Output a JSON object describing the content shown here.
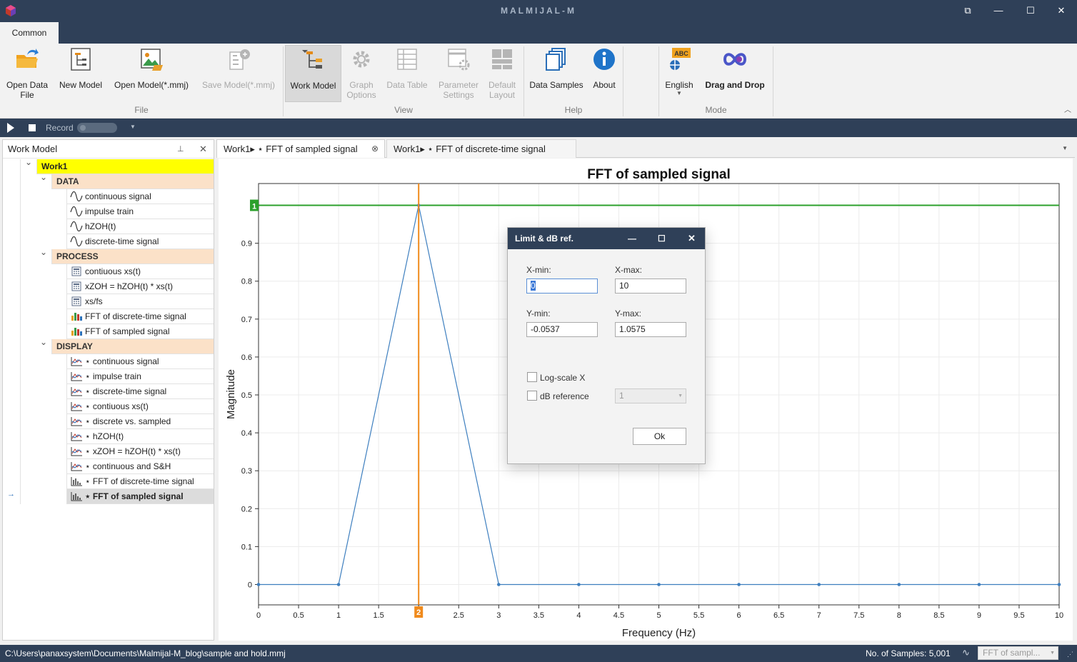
{
  "app": {
    "title": "MALMIJAL-M"
  },
  "ribbon": {
    "tab": "Common",
    "buttons": {
      "open_data": "Open Data File",
      "new_model": "New Model",
      "open_model": "Open Model(*.mmj)",
      "save_model": "Save Model(*.mmj)",
      "work_model": "Work Model",
      "graph_options_1": "Graph",
      "graph_options_2": "Options",
      "data_table": "Data Table",
      "parameter_settings_1": "Parameter",
      "parameter_settings_2": "Settings",
      "default_layout_1": "Default",
      "default_layout_2": "Layout",
      "data_samples": "Data Samples",
      "about": "About",
      "english": "English",
      "drag_drop": "Drag and Drop",
      "open_data_1": "Open Data",
      "open_data_2": "File"
    },
    "groups": {
      "file": "File",
      "view": "View",
      "help": "Help",
      "mode": "Mode"
    }
  },
  "recordbar": {
    "record": "Record"
  },
  "work_model": {
    "header": "Work Model",
    "root": "Work1",
    "groups": [
      {
        "label": "DATA",
        "items": [
          "continuous signal",
          "impulse train",
          "hZOH(t)",
          "discrete-time signal"
        ]
      },
      {
        "label": "PROCESS",
        "items": [
          "contiuous xs(t)",
          "xZOH = hZOH(t) * xs(t)",
          "xs/fs",
          "FFT of discrete-time signal",
          "FFT of sampled signal"
        ]
      },
      {
        "label": "DISPLAY",
        "items": [
          "⋆ continuous signal",
          "⋆ impulse train",
          "⋆ discrete-time signal",
          "⋆ contiuous xs(t)",
          "⋆ discrete vs. sampled",
          "⋆ hZOH(t)",
          "⋆ xZOH = hZOH(t) * xs(t)",
          "⋆ continuous and S&H",
          "⋆ FFT of discrete-time signal",
          "⋆ FFT of sampled signal"
        ]
      }
    ]
  },
  "doc_tabs": [
    "Work1▸ ⋆ FFT of sampled signal",
    "Work1▸ ⋆ FFT of discrete-time signal"
  ],
  "chart_data": {
    "type": "line",
    "title": "FFT of sampled signal",
    "xlabel": "Frequency (Hz)",
    "ylabel": "Magnitude",
    "xlim": [
      0,
      10
    ],
    "ylim": [
      -0.0537,
      1.0575
    ],
    "x_ticks": [
      "0",
      "0.5",
      "1",
      "1.5",
      "2",
      "2.5",
      "3",
      "3.5",
      "4",
      "4.5",
      "5",
      "5.5",
      "6",
      "6.5",
      "7",
      "7.5",
      "8",
      "8.5",
      "9",
      "9.5",
      "10"
    ],
    "y_ticks": [
      "0",
      "0.1",
      "0.2",
      "0.3",
      "0.4",
      "0.5",
      "0.6",
      "0.7",
      "0.8",
      "0.9"
    ],
    "grid": true,
    "series": [
      {
        "x": [
          0,
          1,
          2,
          3,
          4,
          5,
          6,
          7,
          8,
          9,
          10
        ],
        "y": [
          0,
          0,
          1,
          0,
          0,
          0,
          0,
          0,
          0,
          0,
          0
        ],
        "color": "#3e7fbf"
      }
    ],
    "ref_line_y": 1,
    "ref_line_label": "1",
    "ref_line_color": "#2ca02c",
    "cursor_x": 2,
    "cursor_label": "2",
    "cursor_color": "#f08a1c"
  },
  "dialog": {
    "title": "Limit & dB ref.",
    "xmin_label": "X-min:",
    "xmax_label": "X-max:",
    "ymin_label": "Y-min:",
    "ymax_label": "Y-max:",
    "xmin": "0",
    "xmax": "10",
    "ymin": "-0.0537",
    "ymax": "1.0575",
    "logscale_label": "Log-scale X",
    "dbref_label": "dB reference",
    "dbref_value": "1",
    "ok": "Ok"
  },
  "status": {
    "path": "C:\\Users\\panaxsystem\\Documents\\Malmijal-M_blog\\sample and hold.mmj",
    "samples": "No. of Samples: 5,001",
    "selector": "FFT of sampl..."
  }
}
